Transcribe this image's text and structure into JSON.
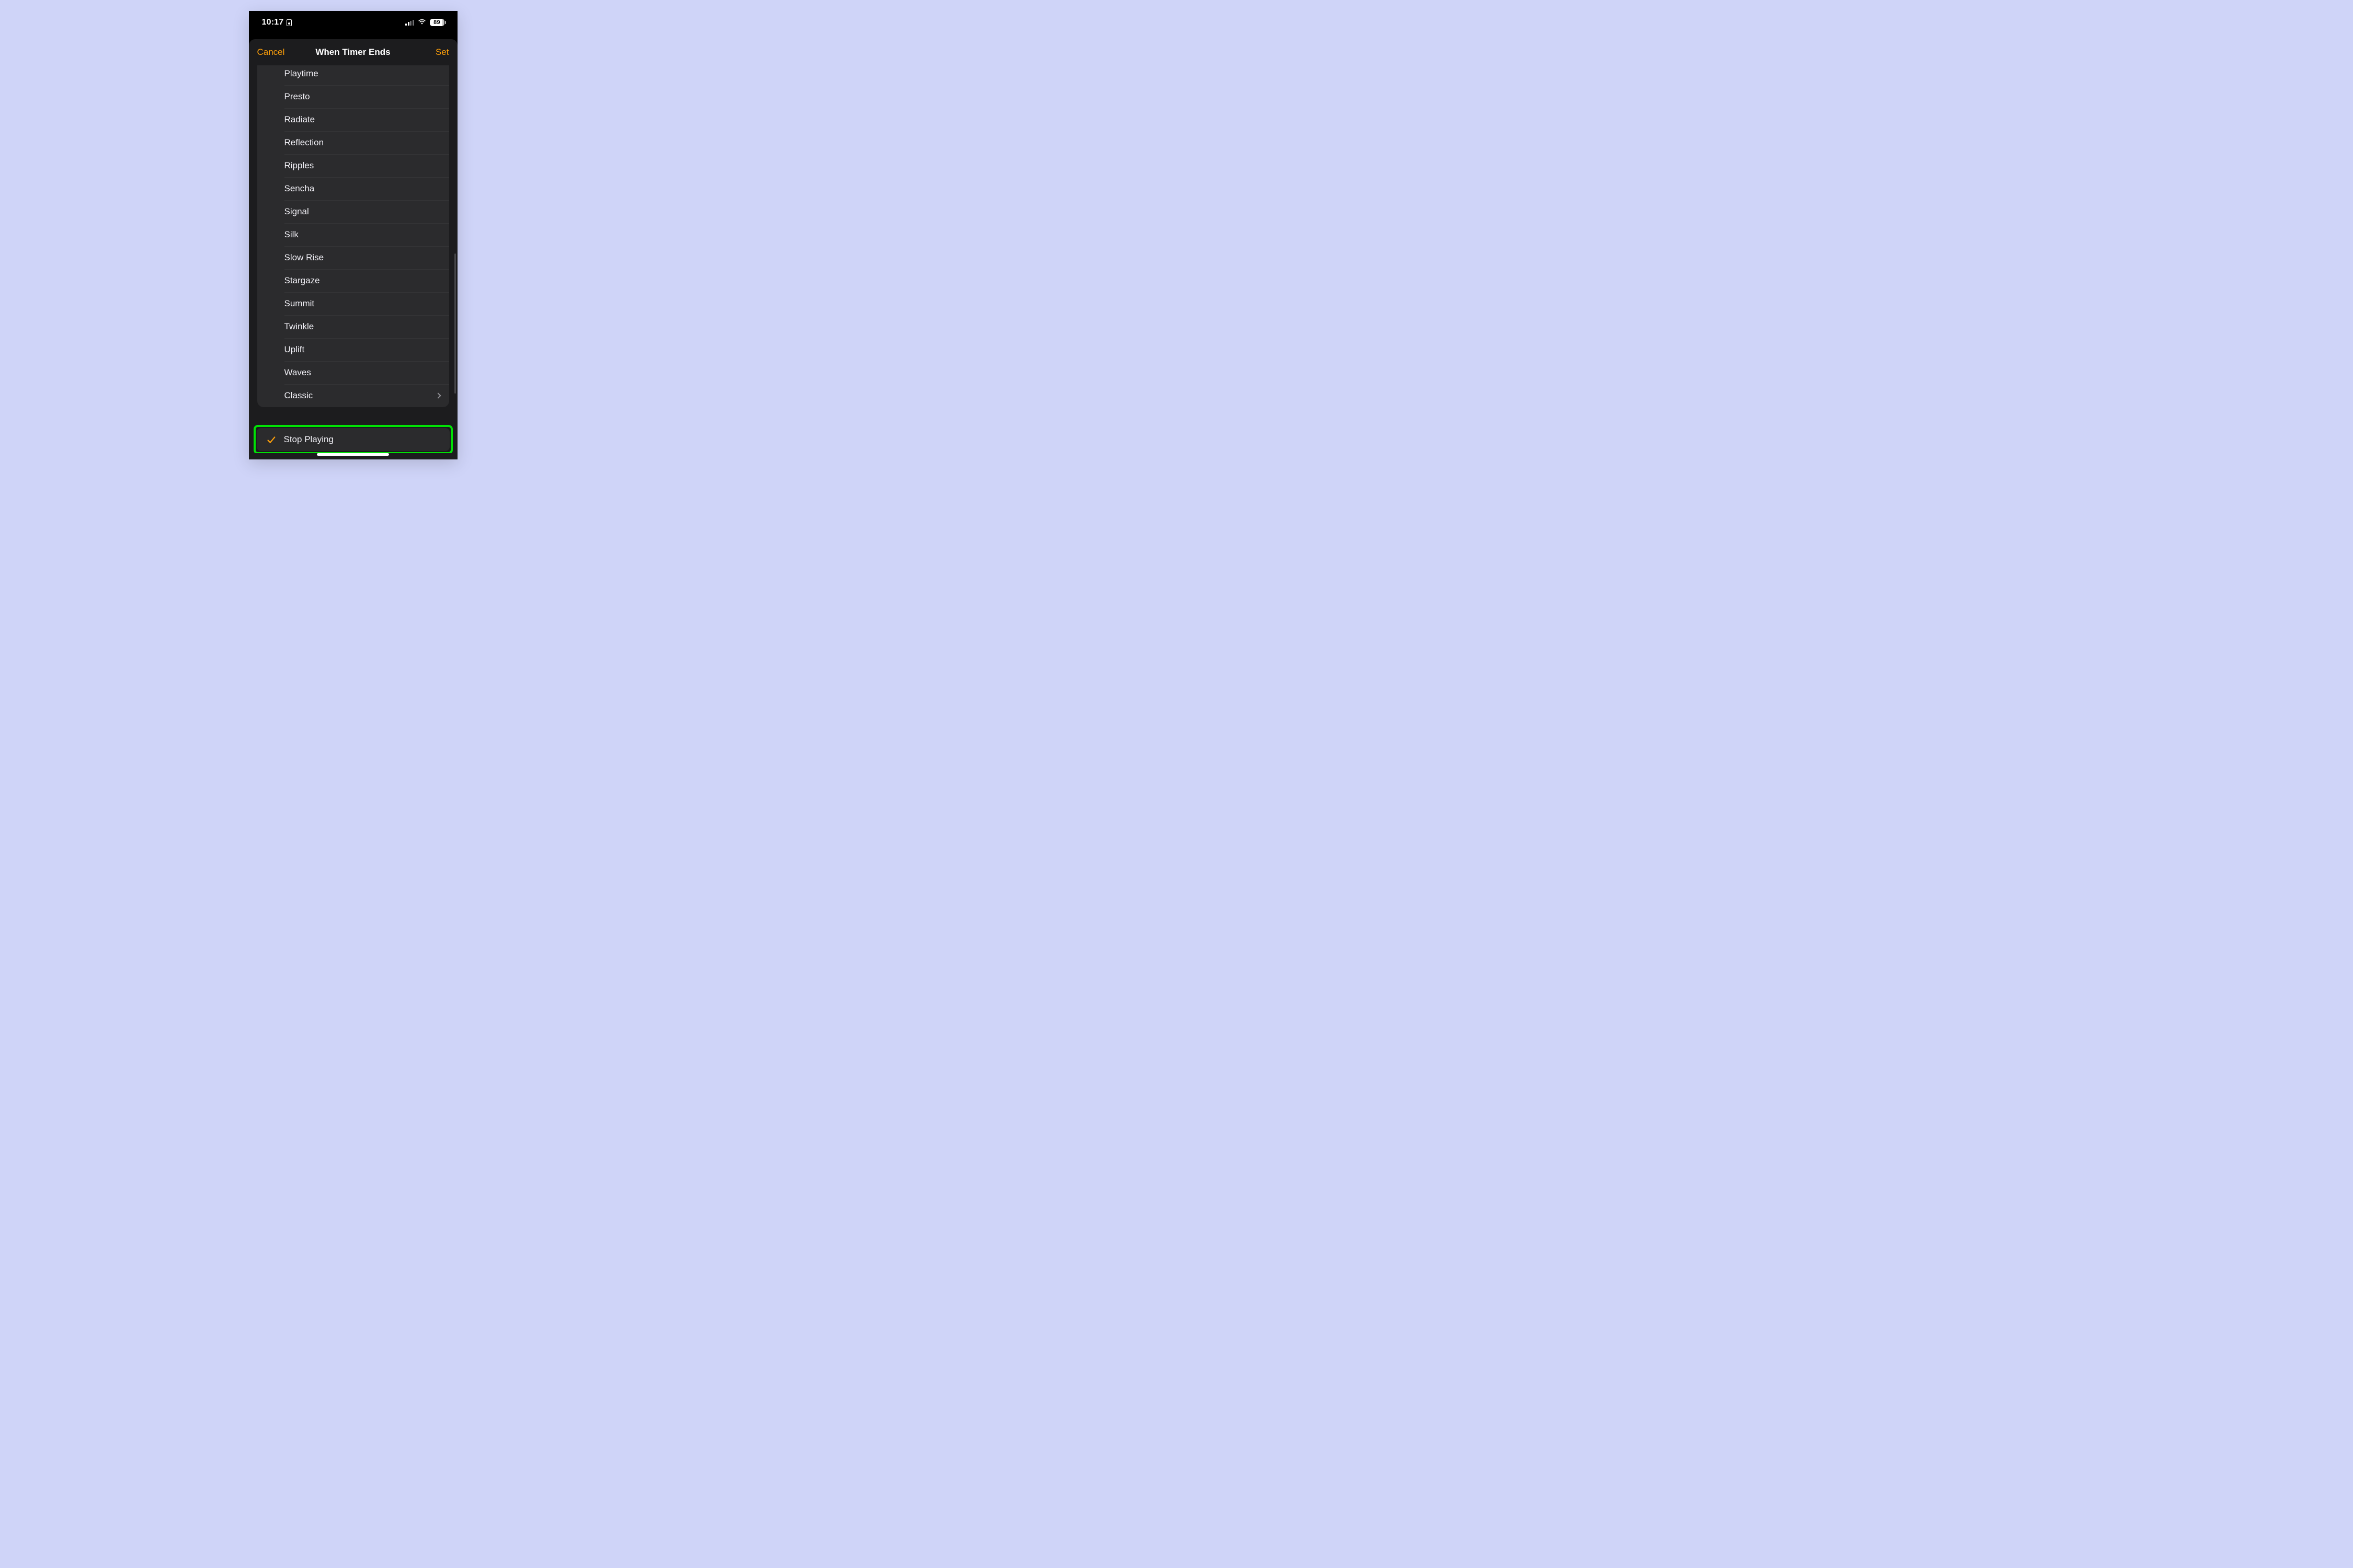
{
  "status": {
    "time": "10:17",
    "battery_pct": "89"
  },
  "sheet": {
    "nav": {
      "cancel": "Cancel",
      "title": "When Timer Ends",
      "set": "Set"
    },
    "sounds": [
      "Playtime",
      "Presto",
      "Radiate",
      "Reflection",
      "Ripples",
      "Sencha",
      "Signal",
      "Silk",
      "Slow Rise",
      "Stargaze",
      "Summit",
      "Twinkle",
      "Uplift",
      "Waves"
    ],
    "classic_label": "Classic",
    "stop_playing_label": "Stop Playing"
  }
}
